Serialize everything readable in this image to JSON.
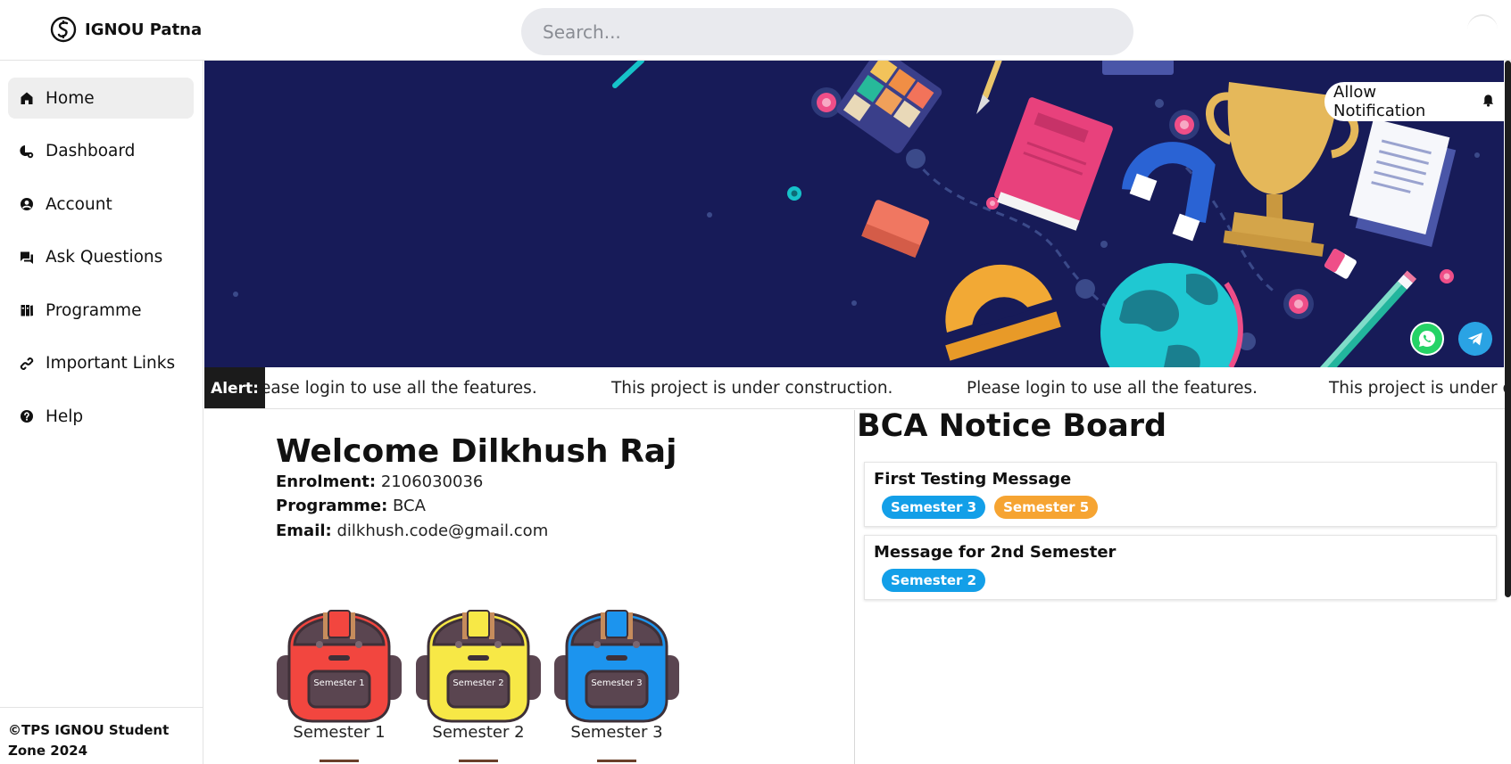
{
  "header": {
    "brand": "IGNOU Patna",
    "search_placeholder": "Search..."
  },
  "sidebar": {
    "items": [
      {
        "label": "Home",
        "icon": "home-icon",
        "active": true
      },
      {
        "label": "Dashboard",
        "icon": "dashboard-icon",
        "active": false
      },
      {
        "label": "Account",
        "icon": "account-icon",
        "active": false
      },
      {
        "label": "Ask Questions",
        "icon": "chat-icon",
        "active": false
      },
      {
        "label": "Programme",
        "icon": "books-icon",
        "active": false
      },
      {
        "label": "Important Links",
        "icon": "link-icon",
        "active": false
      },
      {
        "label": "Help",
        "icon": "help-icon",
        "active": false
      }
    ],
    "footer": "©TPS IGNOU Student Zone 2024"
  },
  "banner": {
    "notification_button": "Allow Notification",
    "social": [
      "whatsapp-icon",
      "telegram-icon"
    ]
  },
  "alert": {
    "label": "Alert:",
    "messages": [
      "ease login to use all the features.",
      "This project is under construction.",
      "Please login to use all the features.",
      "This project is under c"
    ]
  },
  "profile": {
    "welcome": "Welcome Dilkhush Raj",
    "enrolment_label": "Enrolment:",
    "enrolment": "2106030036",
    "programme_label": "Programme:",
    "programme": "BCA",
    "email_label": "Email:",
    "email": "dilkhush.code@gmail.com"
  },
  "semesters": [
    {
      "caption": "Semester 1",
      "bag_text": "Semester 1",
      "color": "#f2463f"
    },
    {
      "caption": "Semester 2",
      "bag_text": "Semester 2",
      "color": "#f7e846"
    },
    {
      "caption": "Semester 3",
      "bag_text": "Semester 3",
      "color": "#1c94ee"
    }
  ],
  "notice_board": {
    "title": "BCA Notice Board",
    "notices": [
      {
        "title": "First Testing Message",
        "tags": [
          {
            "text": "Semester 3",
            "color": "blue"
          },
          {
            "text": "Semester 5",
            "color": "orange"
          }
        ]
      },
      {
        "title": "Message for 2nd Semester",
        "tags": [
          {
            "text": "Semester 2",
            "color": "blue"
          }
        ]
      }
    ]
  },
  "colors": {
    "banner_bg": "#171b58",
    "tag_blue": "#139fe8",
    "tag_orange": "#f6a432",
    "alert_label_bg": "#1b1b1b"
  }
}
